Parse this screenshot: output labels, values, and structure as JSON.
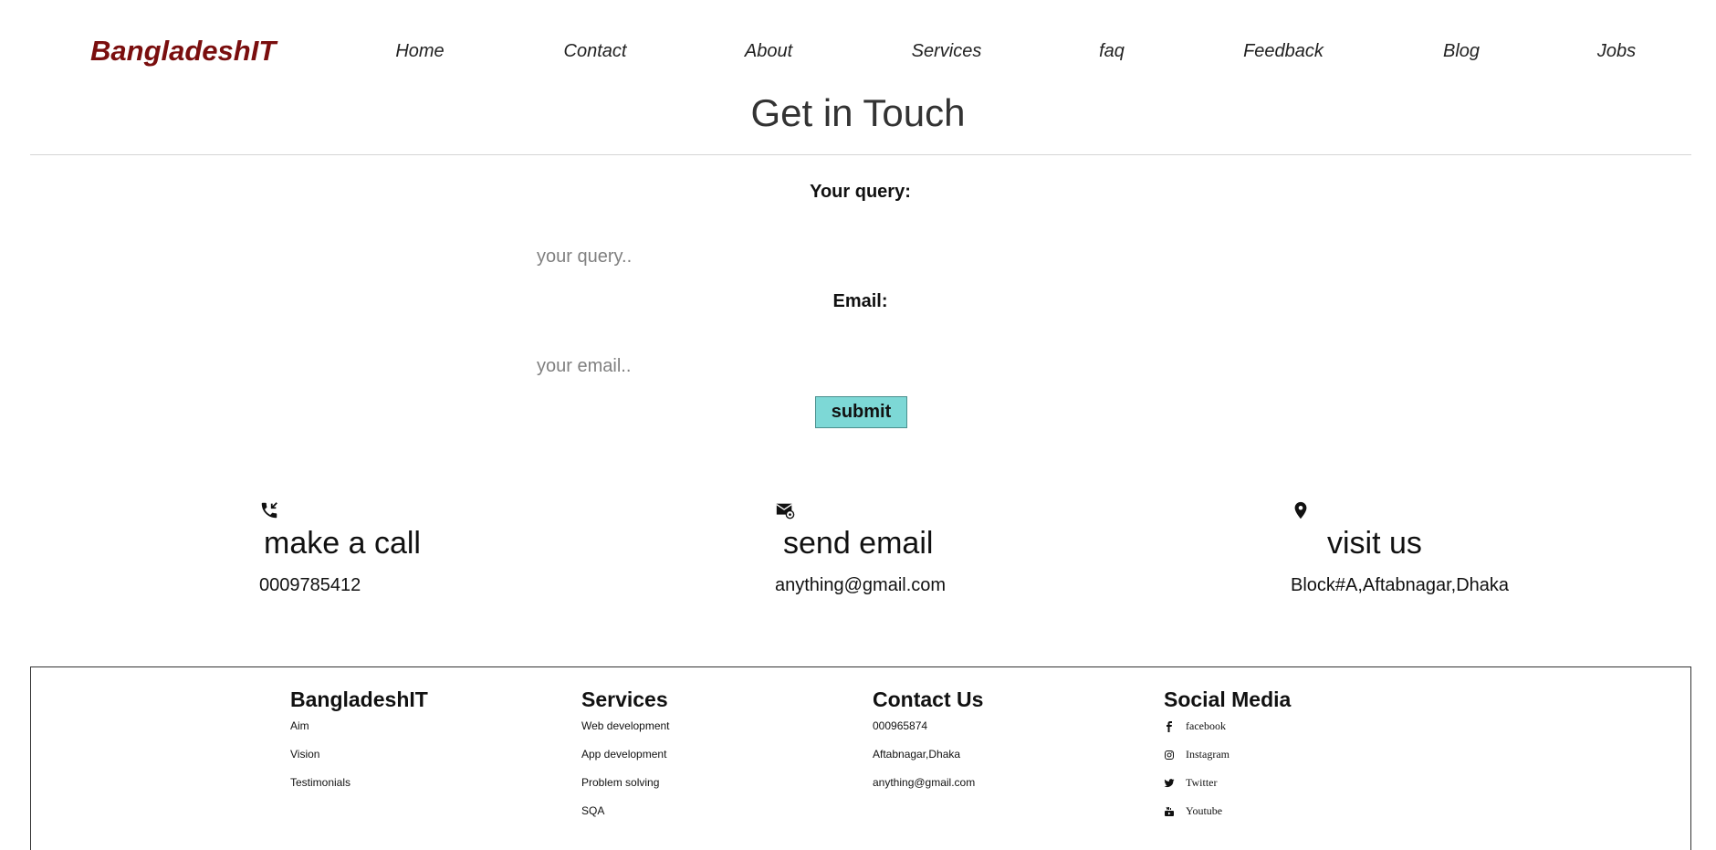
{
  "header": {
    "brand": "BangladeshIT",
    "nav": [
      "Home",
      "Contact",
      "About",
      "Services",
      "faq",
      "Feedback",
      "Blog",
      "Jobs"
    ]
  },
  "page_title": "Get in Touch",
  "form": {
    "query_label": "Your query:",
    "query_placeholder": "your query..",
    "email_label": "Email:",
    "email_placeholder": "your email..",
    "submit_label": "submit"
  },
  "cards": {
    "call": {
      "icon": "phone-icon",
      "title": "make a call",
      "value": "0009785412"
    },
    "email": {
      "icon": "envelope-icon",
      "title": "send email",
      "value": "anything@gmail.com"
    },
    "visit": {
      "icon": "map-pin-icon",
      "title": "visit us",
      "value": "Block#A,Aftabnagar,Dhaka"
    }
  },
  "footer": {
    "company": {
      "heading": "BangladeshIT",
      "links": [
        "Aim",
        "Vision",
        "Testimonials"
      ]
    },
    "services": {
      "heading": "Services",
      "links": [
        "Web development",
        "App development",
        "Problem solving",
        "SQA"
      ]
    },
    "contact": {
      "heading": "Contact Us",
      "items": [
        "000965874",
        "Aftabnagar,Dhaka",
        "anything@gmail.com"
      ]
    },
    "social": {
      "heading": "Social Media",
      "items": [
        {
          "icon": "facebook-icon",
          "label": "facebook"
        },
        {
          "icon": "instagram-icon",
          "label": "Instagram"
        },
        {
          "icon": "twitter-icon",
          "label": "Twitter"
        },
        {
          "icon": "youtube-icon",
          "label": "Youtube"
        }
      ]
    }
  },
  "colors": {
    "brand": "#7a0e0e",
    "submit_bg": "#7dd8d6"
  }
}
